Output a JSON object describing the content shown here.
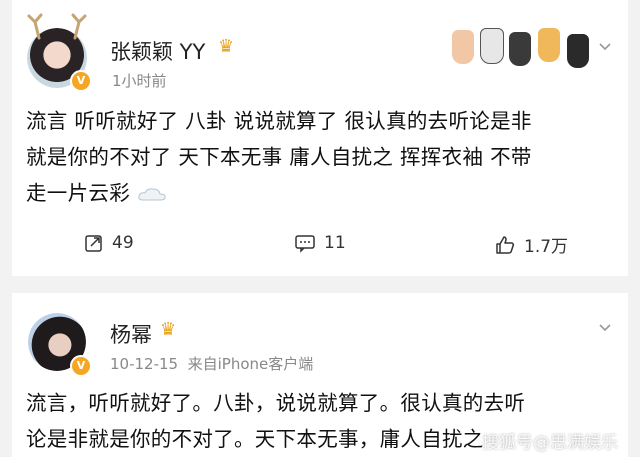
{
  "post1": {
    "author": "张颖颖 YY",
    "time": "1小时前",
    "text_lines": [
      "流言 听听就好了 八卦 说说就算了 很认真的去听论是非",
      "就是你的不对了 天下本无事 庸人自扰之 挥挥衣袖 不带",
      "走一片云彩"
    ],
    "repost_count": "49",
    "comment_count": "11",
    "like_count": "1.7万",
    "verified_mark": "V"
  },
  "post2": {
    "author": "杨幂",
    "date": "10-12-15",
    "source": "来自iPhone客户端",
    "text_lines": [
      "流言，听听就好了。八卦，说说就算了。很认真的去听",
      "论是非就是你的不对了。天下本无事，庸人自扰之"
    ],
    "verified_mark": "V"
  },
  "watermark": "搜狐号@思满娱乐",
  "colors": {
    "accent": "#f5a623",
    "card_bg": "#ffffff",
    "page_bg": "#f2f2f2"
  }
}
